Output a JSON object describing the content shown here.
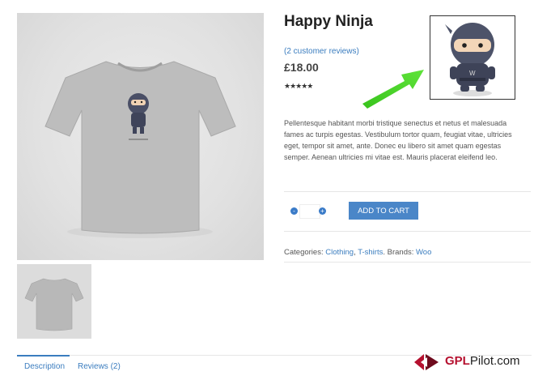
{
  "product": {
    "title": "Happy Ninja",
    "reviews_link": "(2 customer reviews)",
    "price": "£18.00",
    "rating_stars": "★★★★★",
    "rating_value": 5,
    "description": "Pellentesque habitant morbi tristique senectus et netus et malesuada fames ac turpis egestas. Vestibulum tortor quam, feugiat vitae, ultricies eget, tempor sit amet, ante. Donec eu libero sit amet quam egestas semper. Aenean ultricies mi vitae est. Mauris placerat eleifend leo."
  },
  "cart": {
    "minus_symbol": "-",
    "plus_symbol": "+",
    "quantity": "",
    "add_to_cart_label": "ADD TO CART"
  },
  "meta": {
    "categories_label": "Categories:",
    "category_1": "Clothing",
    "category_2": "T-shirts",
    "brands_label": "Brands:",
    "brand_1": "Woo"
  },
  "tabs": {
    "description": "Description",
    "reviews": "Reviews (2)"
  },
  "brand_logo": {
    "text_prefix": "GPL",
    "text_suffix": "Pilot.com"
  },
  "colors": {
    "link": "#3b7dbf",
    "button": "#4a86c8",
    "arrow": "#4fd12a",
    "logo_red": "#b5102f"
  },
  "icons": [
    "tshirt-image",
    "ninja-mascot",
    "green-arrow",
    "gplpilot-logo-icon"
  ]
}
